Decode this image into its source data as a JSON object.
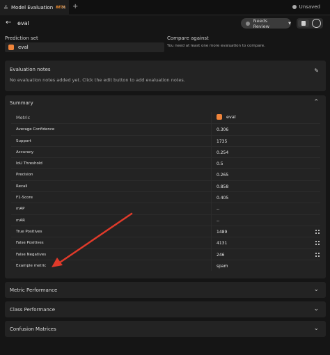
{
  "tab": {
    "title": "Model Evaluation",
    "badge": "BETA",
    "close_symbol": "×",
    "new_tab_symbol": "+"
  },
  "status": {
    "unsaved_label": "Unsaved"
  },
  "header": {
    "back_symbol": "←",
    "evaluation_name": "eval",
    "review_label": "Needs Review",
    "review_caret": "▼"
  },
  "prediction_set": {
    "label": "Prediction set",
    "value": "eval",
    "color": "#f0843a"
  },
  "compare": {
    "label": "Compare against",
    "hint": "You need at least one more evaluation to compare."
  },
  "notes": {
    "title": "Evaluation notes",
    "empty_text": "No evaluation notes added yet. Click the edit button to add evaluation notes.",
    "edit_icon": "edit-notes-icon"
  },
  "summary": {
    "title": "Summary",
    "chevron": "⌃",
    "column_metric": "Metric",
    "column_eval": "eval",
    "rows": [
      {
        "metric": "Average Confidence",
        "value": "0.306"
      },
      {
        "metric": "Support",
        "value": "1735"
      },
      {
        "metric": "Accuracy",
        "value": "0.254"
      },
      {
        "metric": "IoU Threshold",
        "value": "0.5"
      },
      {
        "metric": "Precision",
        "value": "0.265"
      },
      {
        "metric": "Recall",
        "value": "0.858"
      },
      {
        "metric": "F1-Score",
        "value": "0.405"
      },
      {
        "metric": "mAP",
        "value": "--"
      },
      {
        "metric": "mAR",
        "value": "--"
      },
      {
        "metric": "True Positives",
        "value": "1489"
      },
      {
        "metric": "False Positives",
        "value": "4131"
      },
      {
        "metric": "False Negatives",
        "value": "246"
      },
      {
        "metric": "Example metric",
        "value": "spam"
      }
    ]
  },
  "sections": {
    "metric_performance": "Metric Performance",
    "class_performance": "Class Performance",
    "confusion_matrices": "Confusion Matrices",
    "chevron": "⌄"
  },
  "annotation": {
    "arrow_color": "#e03a2a"
  }
}
